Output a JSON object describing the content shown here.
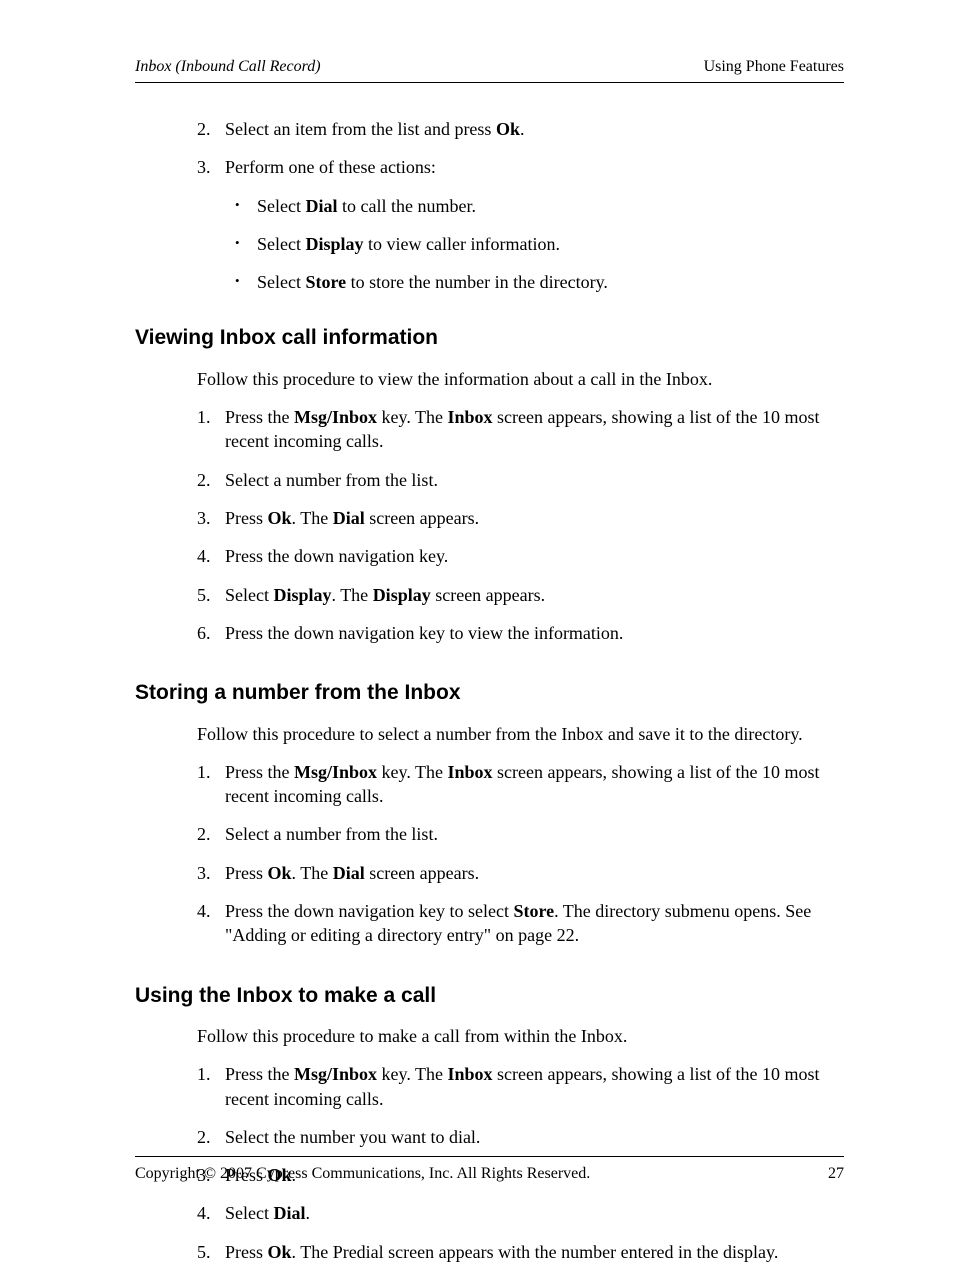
{
  "header": {
    "left": "Inbox (Inbound Call Record)",
    "right": "Using Phone Features"
  },
  "intro_list": {
    "start": 1,
    "items": [
      {
        "pre": "Select an item from the list and press ",
        "bold": "Ok",
        "post": "."
      },
      {
        "pre": "Perform one of these actions:",
        "sub": [
          {
            "pre": "Select ",
            "bold": "Dial",
            "post": " to call the number."
          },
          {
            "pre": "Select ",
            "bold": "Display",
            "post": " to view caller information."
          },
          {
            "pre": "Select ",
            "bold": "Store",
            "post": " to store the number in the directory."
          }
        ]
      }
    ]
  },
  "sections": [
    {
      "title": "Viewing Inbox call information",
      "intro": "Follow this procedure to view the information about a call in the Inbox.",
      "steps": [
        {
          "segments": [
            {
              "t": "Press the "
            },
            {
              "b": "Msg/Inbox"
            },
            {
              "t": " key. The "
            },
            {
              "b": "Inbox"
            },
            {
              "t": " screen appears, showing a list of the 10 most recent incoming calls."
            }
          ]
        },
        {
          "segments": [
            {
              "t": "Select a number from the list."
            }
          ]
        },
        {
          "segments": [
            {
              "t": "Press "
            },
            {
              "b": "Ok"
            },
            {
              "t": ". The "
            },
            {
              "b": "Dial"
            },
            {
              "t": " screen appears."
            }
          ]
        },
        {
          "segments": [
            {
              "t": "Press the down navigation key."
            }
          ]
        },
        {
          "segments": [
            {
              "t": "Select "
            },
            {
              "b": "Display"
            },
            {
              "t": ". The "
            },
            {
              "b": "Display"
            },
            {
              "t": " screen appears."
            }
          ]
        },
        {
          "segments": [
            {
              "t": "Press the down navigation key to view the information."
            }
          ]
        }
      ]
    },
    {
      "title": "Storing a number from the Inbox",
      "intro": "Follow this procedure to select a number from the Inbox and save it to the directory.",
      "steps": [
        {
          "segments": [
            {
              "t": "Press the "
            },
            {
              "b": "Msg/Inbox"
            },
            {
              "t": " key. The "
            },
            {
              "b": "Inbox"
            },
            {
              "t": " screen appears, showing a list of the 10 most recent incoming calls."
            }
          ]
        },
        {
          "segments": [
            {
              "t": "Select a number from the list."
            }
          ]
        },
        {
          "segments": [
            {
              "t": "Press "
            },
            {
              "b": "Ok"
            },
            {
              "t": ". The "
            },
            {
              "b": "Dial"
            },
            {
              "t": " screen appears."
            }
          ]
        },
        {
          "segments": [
            {
              "t": "Press the down navigation key to select "
            },
            {
              "b": "Store"
            },
            {
              "t": ". The directory submenu opens. See \"Adding or editing a directory entry\" on page 22."
            }
          ]
        }
      ]
    },
    {
      "title": "Using the Inbox to make a call",
      "intro": "Follow this procedure to make a call from within the Inbox.",
      "steps": [
        {
          "segments": [
            {
              "t": "Press the "
            },
            {
              "b": "Msg/Inbox"
            },
            {
              "t": " key. The "
            },
            {
              "b": "Inbox"
            },
            {
              "t": " screen appears, showing a list of the 10 most recent incoming calls."
            }
          ]
        },
        {
          "segments": [
            {
              "t": "Select the number you want to dial."
            }
          ]
        },
        {
          "segments": [
            {
              "t": "Press "
            },
            {
              "b": "Ok"
            },
            {
              "t": "."
            }
          ]
        },
        {
          "segments": [
            {
              "t": "Select "
            },
            {
              "b": "Dial"
            },
            {
              "t": "."
            }
          ]
        },
        {
          "segments": [
            {
              "t": "Press "
            },
            {
              "b": "Ok"
            },
            {
              "t": ". The Predial screen appears with the number entered in the display."
            }
          ]
        }
      ]
    }
  ],
  "footer": {
    "copyright": "Copyright © 2007 Cypress Communications, Inc. All Rights Reserved.",
    "page": "27"
  }
}
